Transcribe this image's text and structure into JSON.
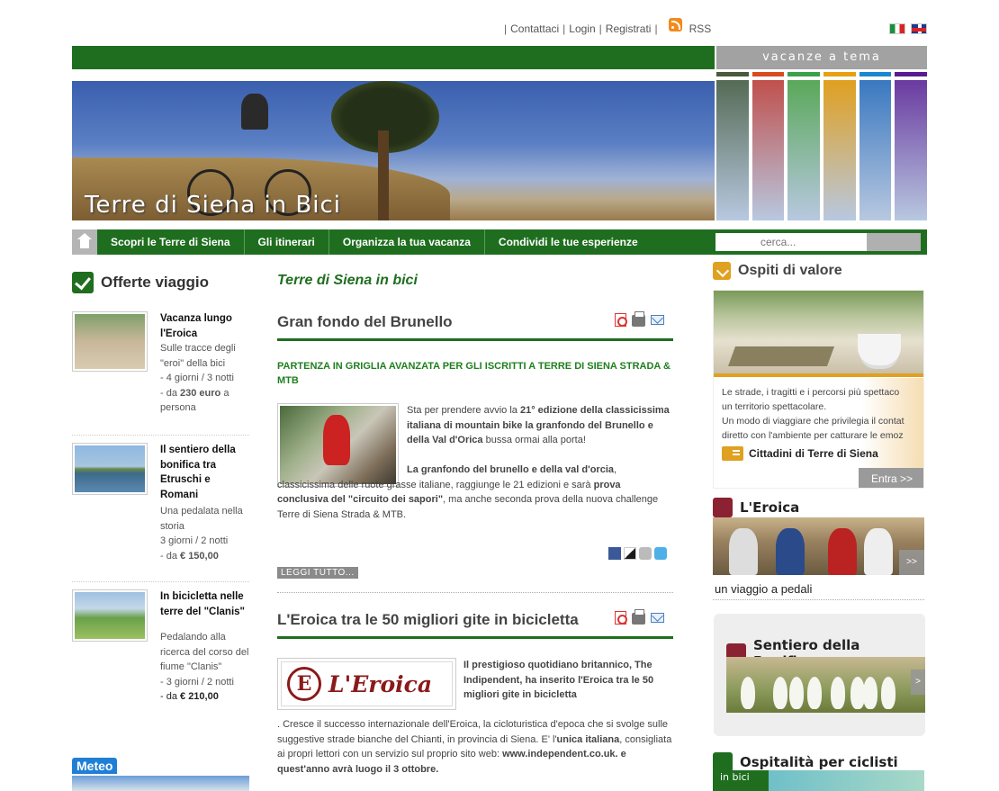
{
  "top_links": {
    "contattaci": "Contattaci",
    "login": "Login",
    "registrati": "Registrati",
    "rss": "RSS"
  },
  "header": {
    "vacanze_tema": "vacanze a tema",
    "hero_title": "Terre di Siena in Bici",
    "stripe_colors": [
      "#556b55",
      "#c0504d",
      "#5aa85a",
      "#e0a020",
      "#3a78c0",
      "#6a3aa0"
    ],
    "stripe_caps": [
      "#4a5a3a",
      "#d84a20",
      "#3aa04a",
      "#e8a010",
      "#1a88d0",
      "#5a1a90"
    ]
  },
  "nav": {
    "items": [
      "Scopri le Terre di Siena",
      "Gli itinerari",
      "Organizza la tua vacanza",
      "Condividi le tue esperienze"
    ],
    "search_placeholder": "cerca..."
  },
  "left": {
    "title": "Offerte viaggio",
    "offers": [
      {
        "title": "Vacanza lungo l'Eroica",
        "desc": "Sulle tracce degli \"eroi\" della bici",
        "line1": "- 4 giorni / 3 notti",
        "price_prefix": "- da ",
        "price": "230 euro",
        "price_suffix": " a persona"
      },
      {
        "title": "Il sentiero della bonifica tra Etruschi e Romani",
        "desc": "Una pedalata nella storia",
        "line1": "3 giorni / 2 notti",
        "price_prefix": "- da ",
        "price": "€ 150,00",
        "price_suffix": ""
      },
      {
        "title": "In bicicletta nelle terre del \"Clanis\"",
        "desc": "Pedalando alla ricerca del corso del fiume \"Clanis\"",
        "line1": "- 3 giorni / 2 notti",
        "price_prefix": "- da ",
        "price": "€ 210,00",
        "price_suffix": ""
      }
    ],
    "meteo": "Meteo"
  },
  "center": {
    "section_title": "Terre di Siena in bici",
    "article1": {
      "title": "Gran fondo del Brunello",
      "subtitle": "PARTENZA IN GRIGLIA AVANZATA PER GLI ISCRITTI A TERRE DI SIENA STRADA & MTB",
      "p1_a": "Sta per prendere avvio la ",
      "p1_b": "21° edizione della classicissima italiana di mountain bike la granfondo del Brunello e della Val d'Orica",
      "p1_c": " bussa ormai alla porta!",
      "p2_a": "La granfondo del brunello e della val d'orcia",
      "p2_b": ", classicissima delle ruote grasse italiane, raggiunge le 21 edizioni e sarà ",
      "p2_c": "prova conclusiva del \"circuito dei sapori\"",
      "p2_d": ", ma anche seconda prova della nuova challenge Terre di Siena Strada & MTB.",
      "read_more": "LEGGI TUTTO..."
    },
    "article2": {
      "title": "L'Eroica tra le 50 migliori gite in bicicletta",
      "logo_letter": "E",
      "logo_word": "L'Eroica",
      "p1_a": "Il prestigioso quotidiano britannico, The Indipendent, ha inserito l'Eroica tra le 50 migliori gite in bicicletta",
      "p1_b": ". Cresce il successo internazionale  dell'Eroica, la cicloturistica d'epoca che si svolge sulle suggestive strade bianche del Chianti, in provincia di Siena. E' l'",
      "p1_c": "unica italiana",
      "p1_d": ", consigliata ai propri lettori con un servizio sul proprio sito web: ",
      "p1_e": "www.independent.co.uk. e quest'anno avrà luogo il 3 ottobre."
    }
  },
  "right": {
    "ospiti_title": "Ospiti di valore",
    "ospiti_lines": [
      "Le strade, i tragitti e i percorsi più spettaco",
      "un territorio spettacolare.",
      "Un modo di viaggiare che privilegia il contat",
      "diretto con l'ambiente per catturare le emoz"
    ],
    "cittadini": "Cittadini di Terre di Siena",
    "entra": "Entra >>",
    "eroica_title": "L'Eroica",
    "eroica_caption": "un viaggio a pedali",
    "arrow": ">>",
    "bonifica_title": "Sentiero della Bonifica",
    "bonifica_arrow": ">",
    "ospitalita_title": "Ospitalità per ciclisti",
    "in_bici": "in bici"
  }
}
